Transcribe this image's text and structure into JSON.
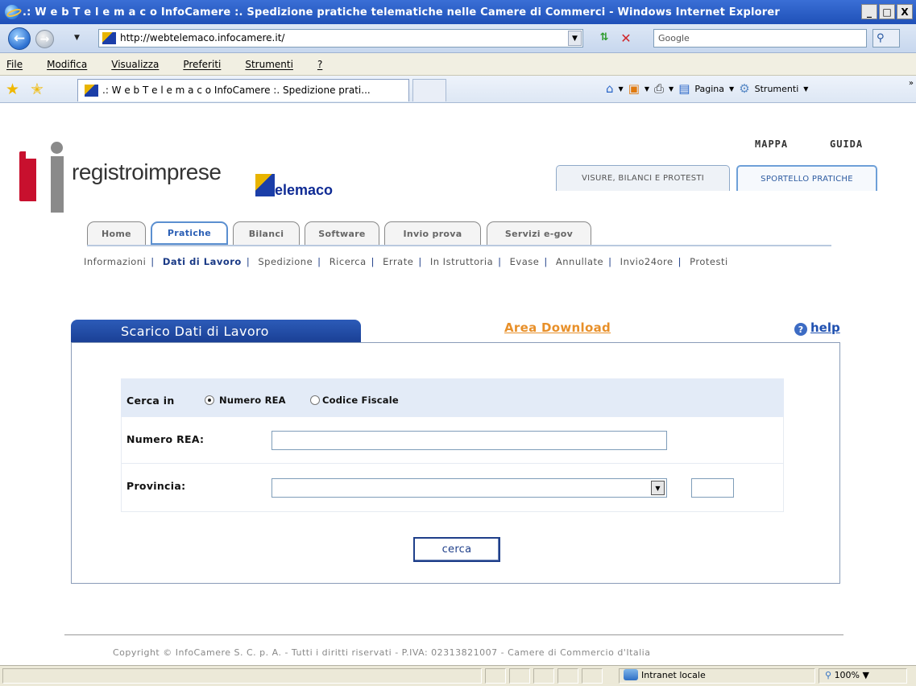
{
  "browser": {
    "window_title": ".: W e b T e l e m a c o InfoCamere :. Spedizione pratiche telematiche nelle Camere di Commerci - Windows Internet Explorer",
    "window_buttons": [
      "_",
      "□",
      "X"
    ],
    "url": "http://webtelemaco.infocamere.it/",
    "search_placeholder": "Google",
    "menu": [
      "File",
      "Modifica",
      "Visualizza",
      "Preferiti",
      "Strumenti",
      "?"
    ],
    "tab_title": ".: W e b T e l e m a c o InfoCamere :. Spedizione prati...",
    "commands": {
      "page": "Pagina",
      "tools": "Strumenti"
    },
    "status": {
      "zone": "Intranet locale",
      "zoom": "100%"
    }
  },
  "page": {
    "logo_text": "registroimprese",
    "telemaco_text": "elemaco",
    "top_links": [
      "MAPPA",
      "GUIDA"
    ],
    "section_tabs": [
      "VISURE, BILANCI E PROTESTI",
      "SPORTELLO PRATICHE"
    ],
    "main_tabs": [
      "Home",
      "Pratiche",
      "Bilanci",
      "Software",
      "Invio prova",
      "Servizi e-gov"
    ],
    "active_main_tab": "Pratiche",
    "sub_nav": [
      "Informazioni",
      "Dati di Lavoro",
      "Spedizione",
      "Ricerca",
      "Errate",
      "In Istruttoria",
      "Evase",
      "Annullate",
      "Invio24ore",
      "Protesti"
    ],
    "active_sub_nav": "Dati di Lavoro",
    "panel_title": "Scarico Dati di Lavoro",
    "area_download": "Area Download",
    "help": "help",
    "form": {
      "cerca_in_label": "Cerca in",
      "radio_numero_rea": "Numero REA",
      "radio_codice_fiscale": "Codice Fiscale",
      "selected_radio": "Numero REA",
      "numero_rea_label": "Numero REA:",
      "provincia_label": "Provincia:",
      "numero_rea_value": "",
      "provincia_value": "",
      "submit": "cerca"
    },
    "copyright": "Copyright © InfoCamere S. C. p. A. - Tutti i diritti riservati - P.IVA: 02313821007 - Camere di Commercio d'Italia"
  },
  "colors": {
    "brand_red": "#c8102e",
    "brand_blue": "#1a3f94",
    "accent_orange": "#e8902a",
    "link_blue": "#1f50b0"
  }
}
